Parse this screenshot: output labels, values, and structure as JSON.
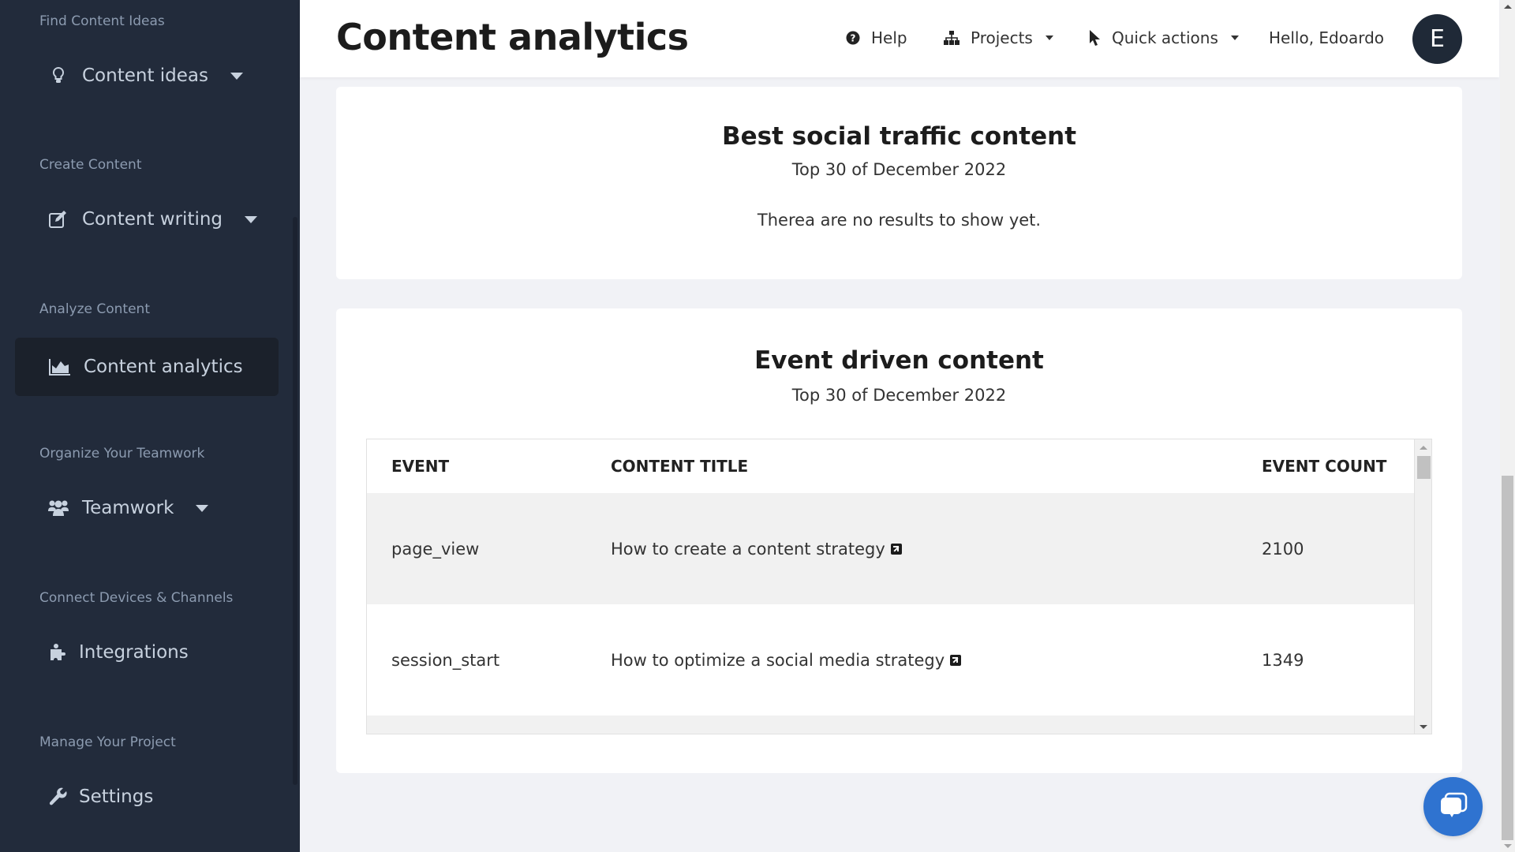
{
  "sidebar": {
    "sections": [
      {
        "label": "Find Content Ideas",
        "item": {
          "label": "Content ideas",
          "icon": "lightbulb-icon",
          "has_dropdown": true
        }
      },
      {
        "label": "Create Content",
        "item": {
          "label": "Content writing",
          "icon": "edit-icon",
          "has_dropdown": true
        }
      },
      {
        "label": "Analyze Content",
        "item": {
          "label": "Content analytics",
          "icon": "area-chart-icon",
          "active": true
        }
      },
      {
        "label": "Organize Your Teamwork",
        "item": {
          "label": "Teamwork",
          "icon": "users-icon",
          "has_dropdown": true
        }
      },
      {
        "label": "Connect Devices & Channels",
        "item": {
          "label": "Integrations",
          "icon": "puzzle-icon"
        }
      },
      {
        "label": "Manage Your Project",
        "item": {
          "label": "Settings",
          "icon": "wrench-icon"
        }
      }
    ]
  },
  "header": {
    "title": "Content analytics",
    "help_label": "Help",
    "projects_label": "Projects",
    "quick_actions_label": "Quick actions",
    "greeting": "Hello, Edoardo",
    "avatar_initial": "E"
  },
  "social_card": {
    "title": "Best social traffic content",
    "subtitle": "Top 30 of December 2022",
    "empty_message": "Therea are no results to show yet."
  },
  "event_card": {
    "title": "Event driven content",
    "subtitle": "Top 30 of December 2022",
    "columns": [
      "EVENT",
      "CONTENT TITLE",
      "EVENT COUNT"
    ],
    "rows": [
      {
        "event": "page_view",
        "title": "How to create a content strategy",
        "count": "2100"
      },
      {
        "event": "session_start",
        "title": "How to optimize a social media strategy",
        "count": "1349"
      }
    ]
  },
  "colors": {
    "sidebar_bg": "#222b3b",
    "accent_chat": "#2f73d0",
    "avatar_bg": "#1f2937"
  }
}
